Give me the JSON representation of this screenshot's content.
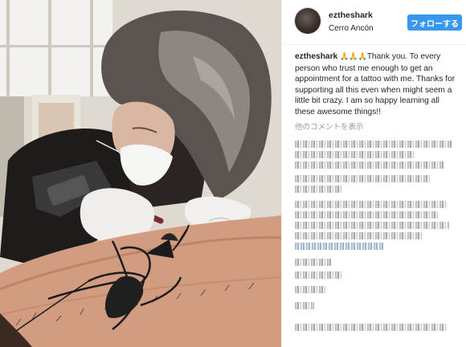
{
  "post": {
    "username": "eztheshark",
    "location": "Cerro Ancón",
    "follow_label": "フォローする",
    "caption_user": "eztheshark",
    "caption_emoji": "🙏🙏🙏",
    "caption_text": "Thank you. To every person who trust me enough to get an appointment for a tattoo with me. Thanks for supporting all this even when might seem a little bit crazy. I am so happy learning all these awesome things!!",
    "more_comments": "他のコメントを表示"
  },
  "colors": {
    "follow_button": "#3897f0",
    "text": "#262626",
    "muted": "#999999"
  },
  "icons": [
    "avatar"
  ]
}
